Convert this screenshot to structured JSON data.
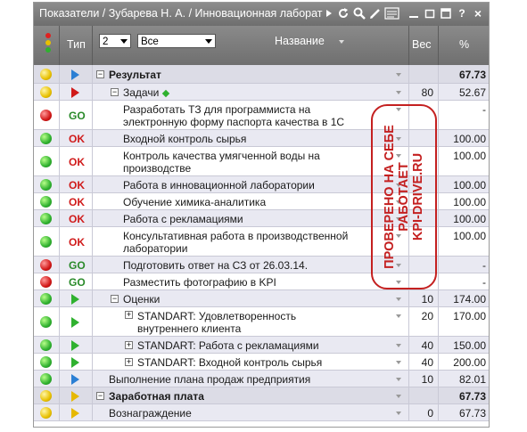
{
  "window": {
    "title": "Показатели / Зубарева Н. А. / Инновационная лаборат",
    "toolbar_icons": [
      "dropdown-arrow-icon",
      "refresh-icon",
      "search-icon",
      "edit-icon",
      "export-icon",
      "minimize-icon",
      "restore-icon",
      "maximize-icon",
      "help-icon",
      "close-icon"
    ],
    "help_label": "?",
    "close_label": "×"
  },
  "header": {
    "type_label": "Тип",
    "level_value": "2",
    "filter_value": "Все",
    "name_label": "Название",
    "weight_label": "Вес",
    "percent_label": "%"
  },
  "rows": [
    {
      "status": "yellow",
      "type": "blue",
      "name": "Результат",
      "expand": "⊟",
      "weight": "",
      "percent": "67.73"
    },
    {
      "status": "yellow",
      "type": "red",
      "name": "Задачи",
      "expand": "⊟",
      "weight": "80",
      "percent": "52.67"
    },
    {
      "status": "red",
      "type": "GO",
      "name": "Разработать ТЗ для программиста на электронную форму паспорта качества в 1С",
      "weight": "",
      "percent": "-"
    },
    {
      "status": "green",
      "type": "OK",
      "name": "Входной контроль сырья",
      "weight": "",
      "percent": "100.00"
    },
    {
      "status": "green",
      "type": "OK",
      "name": "Контроль качества умягченной воды на производстве",
      "weight": "",
      "percent": "100.00"
    },
    {
      "status": "green",
      "type": "OK",
      "name": "Работа в инновационной лаборатории",
      "weight": "",
      "percent": "100.00"
    },
    {
      "status": "green",
      "type": "OK",
      "name": "Обучение химика-аналитика",
      "weight": "",
      "percent": "100.00"
    },
    {
      "status": "green",
      "type": "OK",
      "name": "Работа с рекламациями",
      "weight": "",
      "percent": "100.00"
    },
    {
      "status": "green",
      "type": "OK",
      "name": "Консультативная работа в производственной лаборатории",
      "weight": "",
      "percent": "100.00"
    },
    {
      "status": "red",
      "type": "GO",
      "name": "Подготовить ответ на СЗ от 26.03.14.",
      "weight": "",
      "percent": "-"
    },
    {
      "status": "red",
      "type": "GO",
      "name": "Разместить фотографию в KPI",
      "weight": "",
      "percent": "-"
    },
    {
      "status": "green",
      "type": "green",
      "name": "Оценки",
      "expand": "⊟",
      "weight": "10",
      "percent": "174.00"
    },
    {
      "status": "green",
      "type": "green",
      "name": "STANDART: Удовлетворенность внутреннего клиента",
      "expand": "⊞",
      "weight": "20",
      "percent": "170.00"
    },
    {
      "status": "green",
      "type": "green",
      "name": "STANDART: Работа с рекламациями",
      "expand": "⊞",
      "weight": "40",
      "percent": "150.00"
    },
    {
      "status": "green",
      "type": "green",
      "name": "STANDART: Входной контроль сырья",
      "expand": "⊞",
      "weight": "40",
      "percent": "200.00"
    },
    {
      "status": "green",
      "type": "blue",
      "name": "Выполнение плана продаж предприятия",
      "weight": "10",
      "percent": "82.01"
    },
    {
      "status": "yellow",
      "type": "yellow",
      "name": "Заработная плата",
      "expand": "⊟",
      "weight": "",
      "percent": "67.73"
    },
    {
      "status": "yellow",
      "type": "yellow",
      "name": "Вознаграждение",
      "weight": "0",
      "percent": "67.73"
    }
  ],
  "stamp": {
    "line1": "ПРОВЕРЕНО НА СЕБЕ",
    "line2": "РАБОТАЕТ",
    "line3": "KPI-DRIVE.RU"
  },
  "colors": {
    "header_bg": "#7a7a7a",
    "row_alt": "#e9e9f2",
    "status_red": "#d21818",
    "status_green": "#2fb12f",
    "status_yellow": "#e8c000",
    "stamp": "#c42020"
  }
}
